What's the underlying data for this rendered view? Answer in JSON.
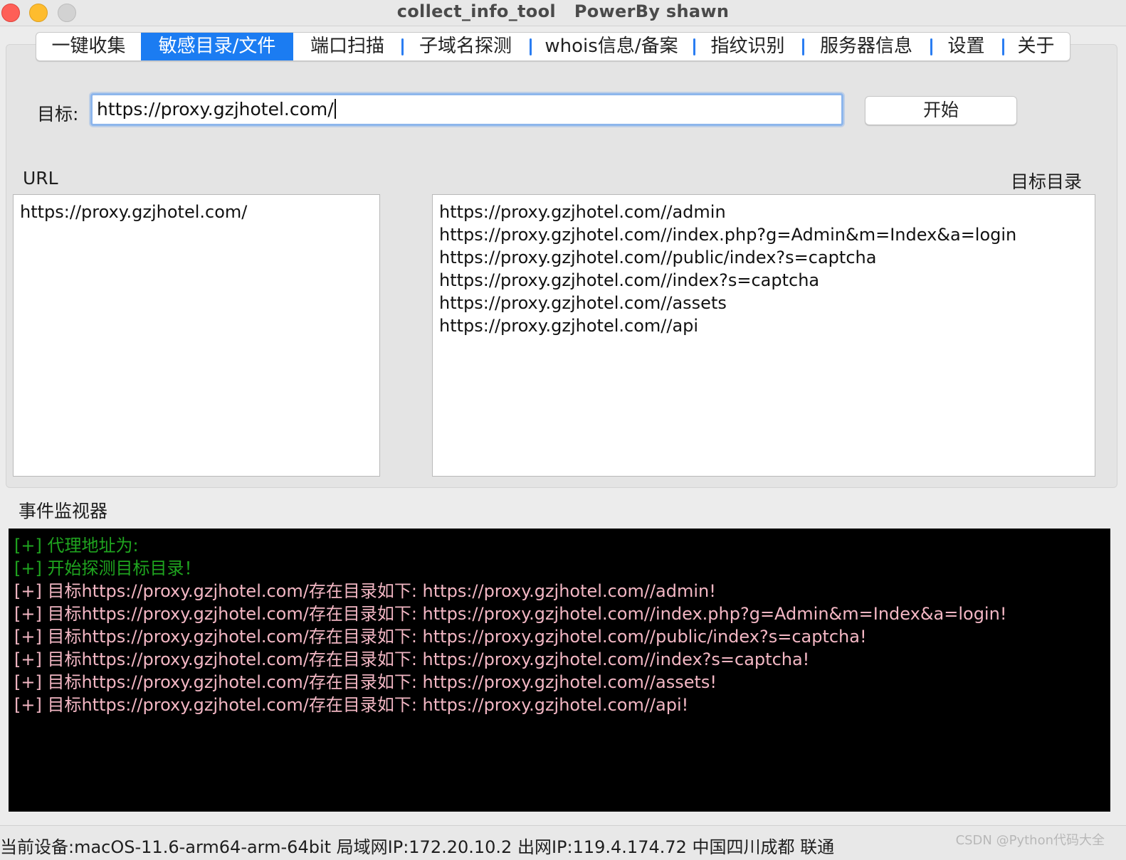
{
  "window": {
    "title": "collect_info_tool   PowerBy shawn"
  },
  "tabs": [
    {
      "label": "一键收集",
      "active": false
    },
    {
      "label": "敏感目录/文件",
      "active": true
    },
    {
      "label": "端口扫描",
      "active": false
    },
    {
      "label": "子域名探测",
      "active": false
    },
    {
      "label": "whois信息/备案",
      "active": false
    },
    {
      "label": "指纹识别",
      "active": false
    },
    {
      "label": "服务器信息",
      "active": false
    },
    {
      "label": "设置",
      "active": false
    },
    {
      "label": "关于",
      "active": false
    }
  ],
  "target": {
    "label": "目标:",
    "value": "https://proxy.gzjhotel.com/"
  },
  "start_button": "开始",
  "url_section": {
    "label": "URL",
    "items": [
      "https://proxy.gzjhotel.com/"
    ]
  },
  "dir_section": {
    "label": "目标目录",
    "items": [
      "https://proxy.gzjhotel.com//admin",
      "https://proxy.gzjhotel.com//index.php?g=Admin&m=Index&a=login",
      "https://proxy.gzjhotel.com//public/index?s=captcha",
      "https://proxy.gzjhotel.com//index?s=captcha",
      "https://proxy.gzjhotel.com//assets",
      "https://proxy.gzjhotel.com//api"
    ]
  },
  "monitor": {
    "label": "事件监视器",
    "logs": [
      {
        "text": "[+] 代理地址为:",
        "color": "#1fa51f"
      },
      {
        "text": "[+] 开始探测目标目录！",
        "color": "#1fa51f"
      },
      {
        "text": "[+] 目标https://proxy.gzjhotel.com/存在目录如下:  https://proxy.gzjhotel.com//admin!",
        "color": "#f3b7c4"
      },
      {
        "text": "[+] 目标https://proxy.gzjhotel.com/存在目录如下:  https://proxy.gzjhotel.com//index.php?g=Admin&m=Index&a=login!",
        "color": "#f3b7c4"
      },
      {
        "text": "[+] 目标https://proxy.gzjhotel.com/存在目录如下:  https://proxy.gzjhotel.com//public/index?s=captcha!",
        "color": "#f3b7c4"
      },
      {
        "text": "[+] 目标https://proxy.gzjhotel.com/存在目录如下:  https://proxy.gzjhotel.com//index?s=captcha!",
        "color": "#f3b7c4"
      },
      {
        "text": "[+] 目标https://proxy.gzjhotel.com/存在目录如下:  https://proxy.gzjhotel.com//assets!",
        "color": "#f3b7c4"
      },
      {
        "text": "[+] 目标https://proxy.gzjhotel.com/存在目录如下:  https://proxy.gzjhotel.com//api!",
        "color": "#f3b7c4"
      }
    ]
  },
  "status": {
    "text": "当前设备:macOS-11.6-arm64-arm-64bit  局域网IP:172.20.10.2  出网IP:119.4.174.72  中国四川成都 联通",
    "watermark": "CSDN @Python代码大全"
  },
  "colors": {
    "accent": "#1b7cf2",
    "console_bg": "#000000",
    "log_green": "#1fa51f",
    "log_pink": "#f3b7c4"
  }
}
